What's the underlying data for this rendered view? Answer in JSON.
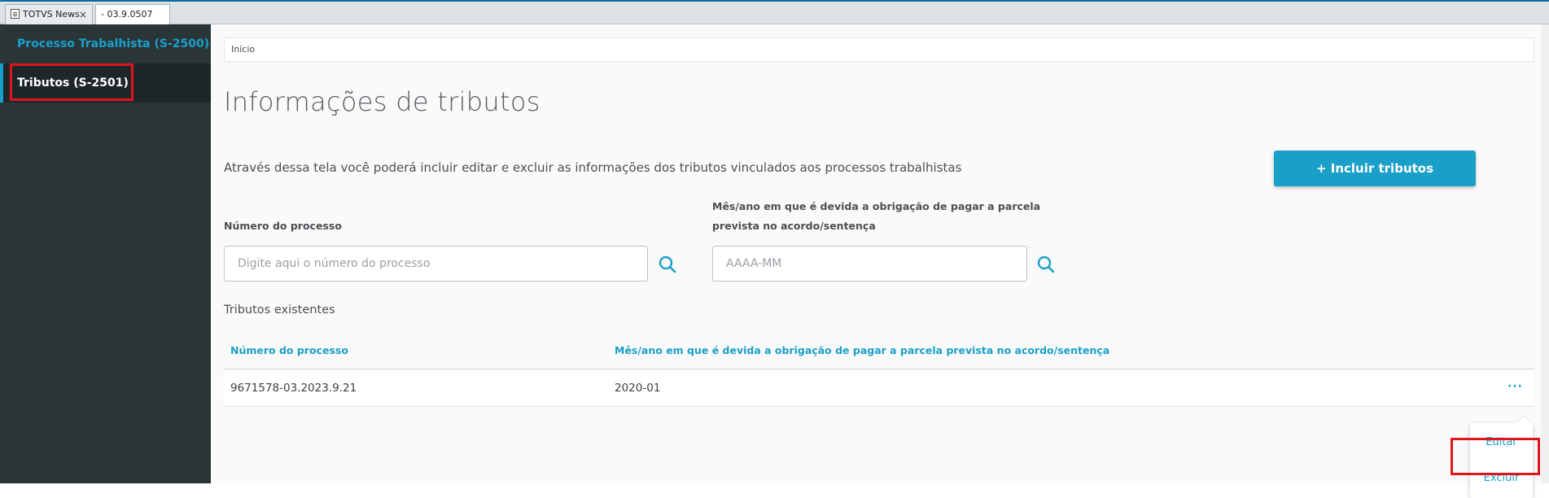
{
  "tabs": [
    {
      "label": "TOTVS News",
      "close": "×"
    },
    {
      "label": "- 03.9.0507",
      "close": "×"
    }
  ],
  "sidebar": {
    "items": [
      {
        "label": "Processo Trabalhista (S-2500)"
      },
      {
        "label": "Tributos (S-2501)"
      }
    ]
  },
  "breadcrumb": {
    "label": "Início"
  },
  "page": {
    "title": "Informações de tributos",
    "description": "Através dessa tela você poderá incluir editar e excluir as informações dos tributos vinculados aos processos trabalhistas",
    "add_button": "+ Incluir tributos"
  },
  "filters": {
    "process": {
      "label": "Número do processo",
      "placeholder": "Digite aqui o número do processo"
    },
    "period": {
      "label_line1": "Mês/ano em que é devida a obrigação de pagar a parcela",
      "label_line2": "prevista no acordo/sentença",
      "placeholder": "AAAA-MM"
    }
  },
  "table": {
    "title": "Tributos existentes",
    "columns": [
      "Número do processo",
      "Mês/ano em que é devida a obrigação de pagar a parcela prevista no acordo/sentença"
    ],
    "rows": [
      {
        "process": "9671578-03.2023.9.21",
        "period": "2020-01",
        "actions": "···"
      }
    ]
  },
  "row_menu": {
    "items": [
      "Editar",
      "Excluir"
    ]
  },
  "colors": {
    "accent": "#1a9fc9",
    "sidebar_bg": "#2a3538",
    "highlight": "#e0151c"
  }
}
